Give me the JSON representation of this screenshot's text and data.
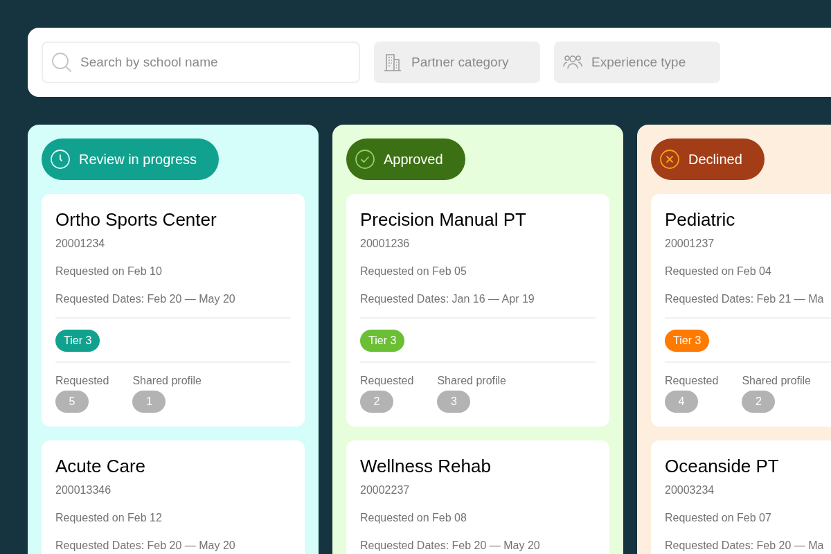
{
  "search": {
    "placeholder": "Search by school name"
  },
  "filters": [
    {
      "label": "Partner category",
      "kind": "building"
    },
    {
      "label": "Experience type",
      "kind": "people"
    }
  ],
  "columns": [
    {
      "status": "Review in progress",
      "kind": "review",
      "cards": [
        {
          "title": "Ortho Sports Center",
          "id": "20001234",
          "requested_on": "Requested on Feb 10",
          "requested_dates": "Requested Dates: Feb 20 — May 20",
          "tier": "Tier 3",
          "stats": [
            {
              "label": "Requested",
              "count": "5"
            },
            {
              "label": "Shared profile",
              "count": "1"
            }
          ]
        },
        {
          "title": "Acute Care",
          "id": "200013346",
          "requested_on": "Requested on Feb 12",
          "requested_dates": "Requested Dates: Feb 20 — May 20"
        }
      ]
    },
    {
      "status": "Approved",
      "kind": "approved",
      "cards": [
        {
          "title": "Precision Manual PT",
          "id": "20001236",
          "requested_on": "Requested on Feb 05",
          "requested_dates": "Requested Dates: Jan 16 — Apr 19",
          "tier": "Tier 3",
          "stats": [
            {
              "label": "Requested",
              "count": "2"
            },
            {
              "label": "Shared profile",
              "count": "3"
            }
          ]
        },
        {
          "title": "Wellness Rehab",
          "id": "20002237",
          "requested_on": "Requested on Feb 08",
          "requested_dates": "Requested Dates: Feb 20 — May 20"
        }
      ]
    },
    {
      "status": "Declined",
      "kind": "declined",
      "cards": [
        {
          "title": "Pediatric",
          "id": "20001237",
          "requested_on": "Requested on Feb 04",
          "requested_dates": "Requested Dates: Feb 21 — Ma",
          "tier": "Tier 3",
          "stats": [
            {
              "label": "Requested",
              "count": "4"
            },
            {
              "label": "Shared profile",
              "count": "2"
            }
          ]
        },
        {
          "title": "Oceanside PT",
          "id": "20003234",
          "requested_on": "Requested on Feb 07",
          "requested_dates": "Requested Dates: Feb 20 — Ma"
        }
      ]
    }
  ]
}
